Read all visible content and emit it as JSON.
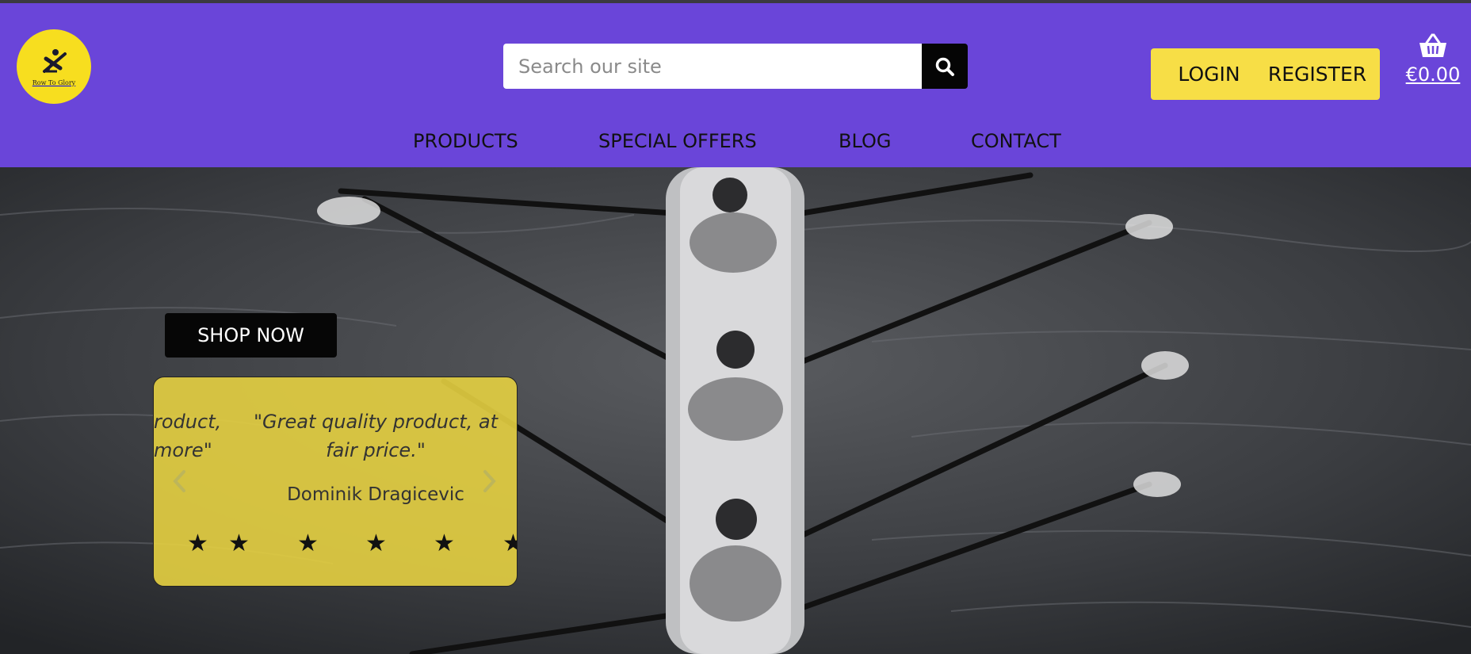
{
  "brand": {
    "logo_text": "Row To Glory",
    "colors": {
      "header": "#6a45d9",
      "accent_yellow": "#f7de46",
      "logo_yellow": "#f7de1f",
      "dark": "#060606"
    }
  },
  "search": {
    "placeholder": "Search our site",
    "value": "",
    "button_icon": "search-icon"
  },
  "auth": {
    "login_label": "LOGIN",
    "register_label": "REGISTER"
  },
  "cart": {
    "icon": "basket-icon",
    "total": "€0.00"
  },
  "nav": {
    "items": [
      {
        "label": "PRODUCTS"
      },
      {
        "label": "SPECIAL OFFERS"
      },
      {
        "label": "BLOG"
      },
      {
        "label": "CONTACT"
      }
    ]
  },
  "hero": {
    "shop_now_label": "SHOP NOW",
    "testimonial": {
      "prev_quote_line1": "roduct,",
      "prev_quote_line2": "more\"",
      "quote": "\"Great quality product, at fair price.\"",
      "author": "Dominik Dragicevic",
      "rating": 5,
      "prev_icon": "chevron-left-icon",
      "next_icon": "chevron-right-icon"
    }
  }
}
